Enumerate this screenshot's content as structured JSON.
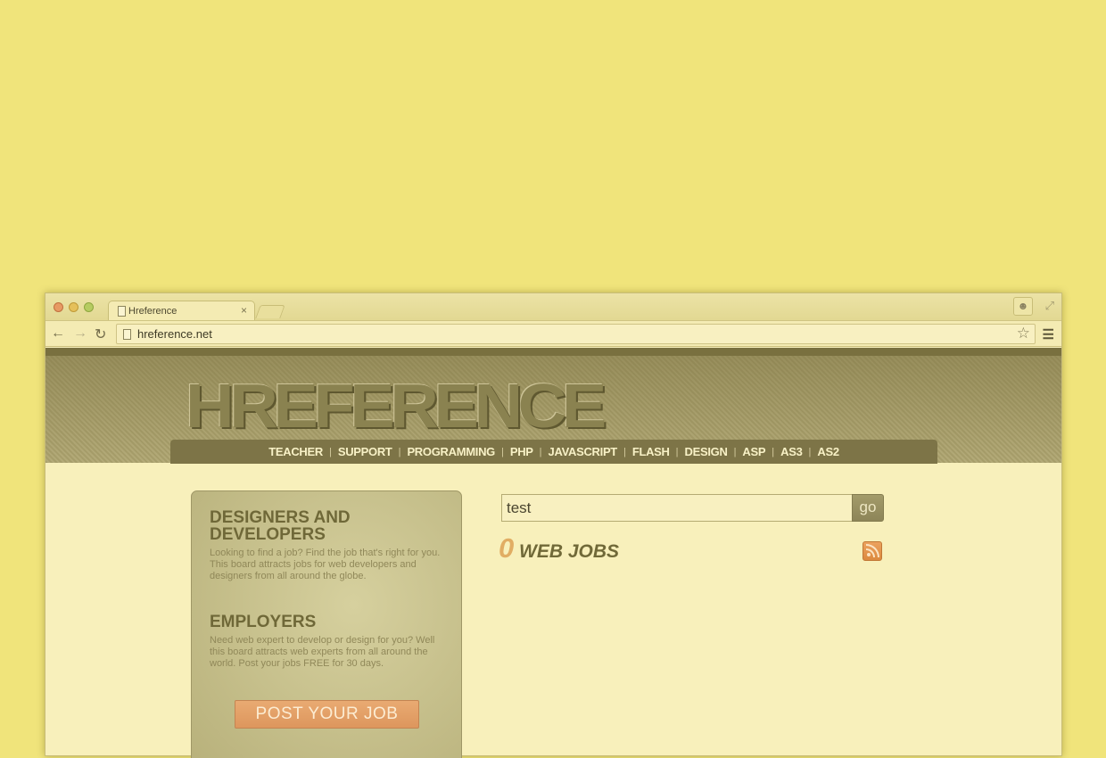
{
  "browser": {
    "tab_title": "Hreference",
    "tab_close": "×",
    "url": "hreference.net"
  },
  "site": {
    "logo_text": "HREFERENCE",
    "nav": [
      "TEACHER",
      "SUPPORT",
      "PROGRAMMING",
      "PHP",
      "JAVASCRIPT",
      "FLASH",
      "DESIGN",
      "ASP",
      "AS3",
      "AS2"
    ],
    "nav_separator": "|"
  },
  "sidebar": {
    "designers_heading_line1": "DESIGNERS AND",
    "designers_heading_line2": "DEVELOPERS",
    "designers_text": "Looking to find a job? Find the job that's right for you. This board attracts jobs for web developers and designers from all around the globe.",
    "employers_heading": "EMPLOYERS",
    "employers_text": "Need web expert to develop or design for you? Well this board attracts web experts from all around the world. Post your jobs FREE for 30 days.",
    "post_button": "POST YOUR JOB"
  },
  "search": {
    "value": "test",
    "go_label": "go"
  },
  "results": {
    "count": "0",
    "label": "WEB JOBS"
  },
  "colors": {
    "background": "#f0e47b",
    "accent_orange": "#e1ad63",
    "nav_bar": "#7d7447"
  }
}
